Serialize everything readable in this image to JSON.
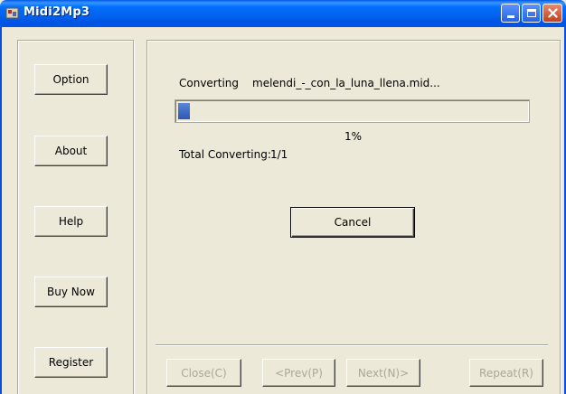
{
  "window": {
    "title": "Midi2Mp3",
    "icon": "app-icon",
    "controls": [
      "minimize-icon",
      "maximize-icon",
      "close-icon"
    ]
  },
  "sidebar": {
    "buttons": [
      {
        "label": "Option"
      },
      {
        "label": "About"
      },
      {
        "label": "Help"
      },
      {
        "label": "Buy Now"
      },
      {
        "label": "Register"
      }
    ]
  },
  "main": {
    "converting_label": "Converting",
    "converting_file": "melendi_-_con_la_luna_llena.mid...",
    "progress_fraction": 0.01,
    "progress_percent": "1%",
    "total_label": "Total Converting:",
    "total_value": "1/1",
    "cancel_label": "Cancel"
  },
  "footer": {
    "close_label": "Close(C)",
    "prev_label": "<Prev(P)",
    "next_label": "Next(N)>",
    "repeat_label": "Repeat(R)"
  },
  "colors": {
    "titlebar": "#0054e3",
    "progress_fill": "#2c57b4",
    "face": "#ece9d8"
  }
}
